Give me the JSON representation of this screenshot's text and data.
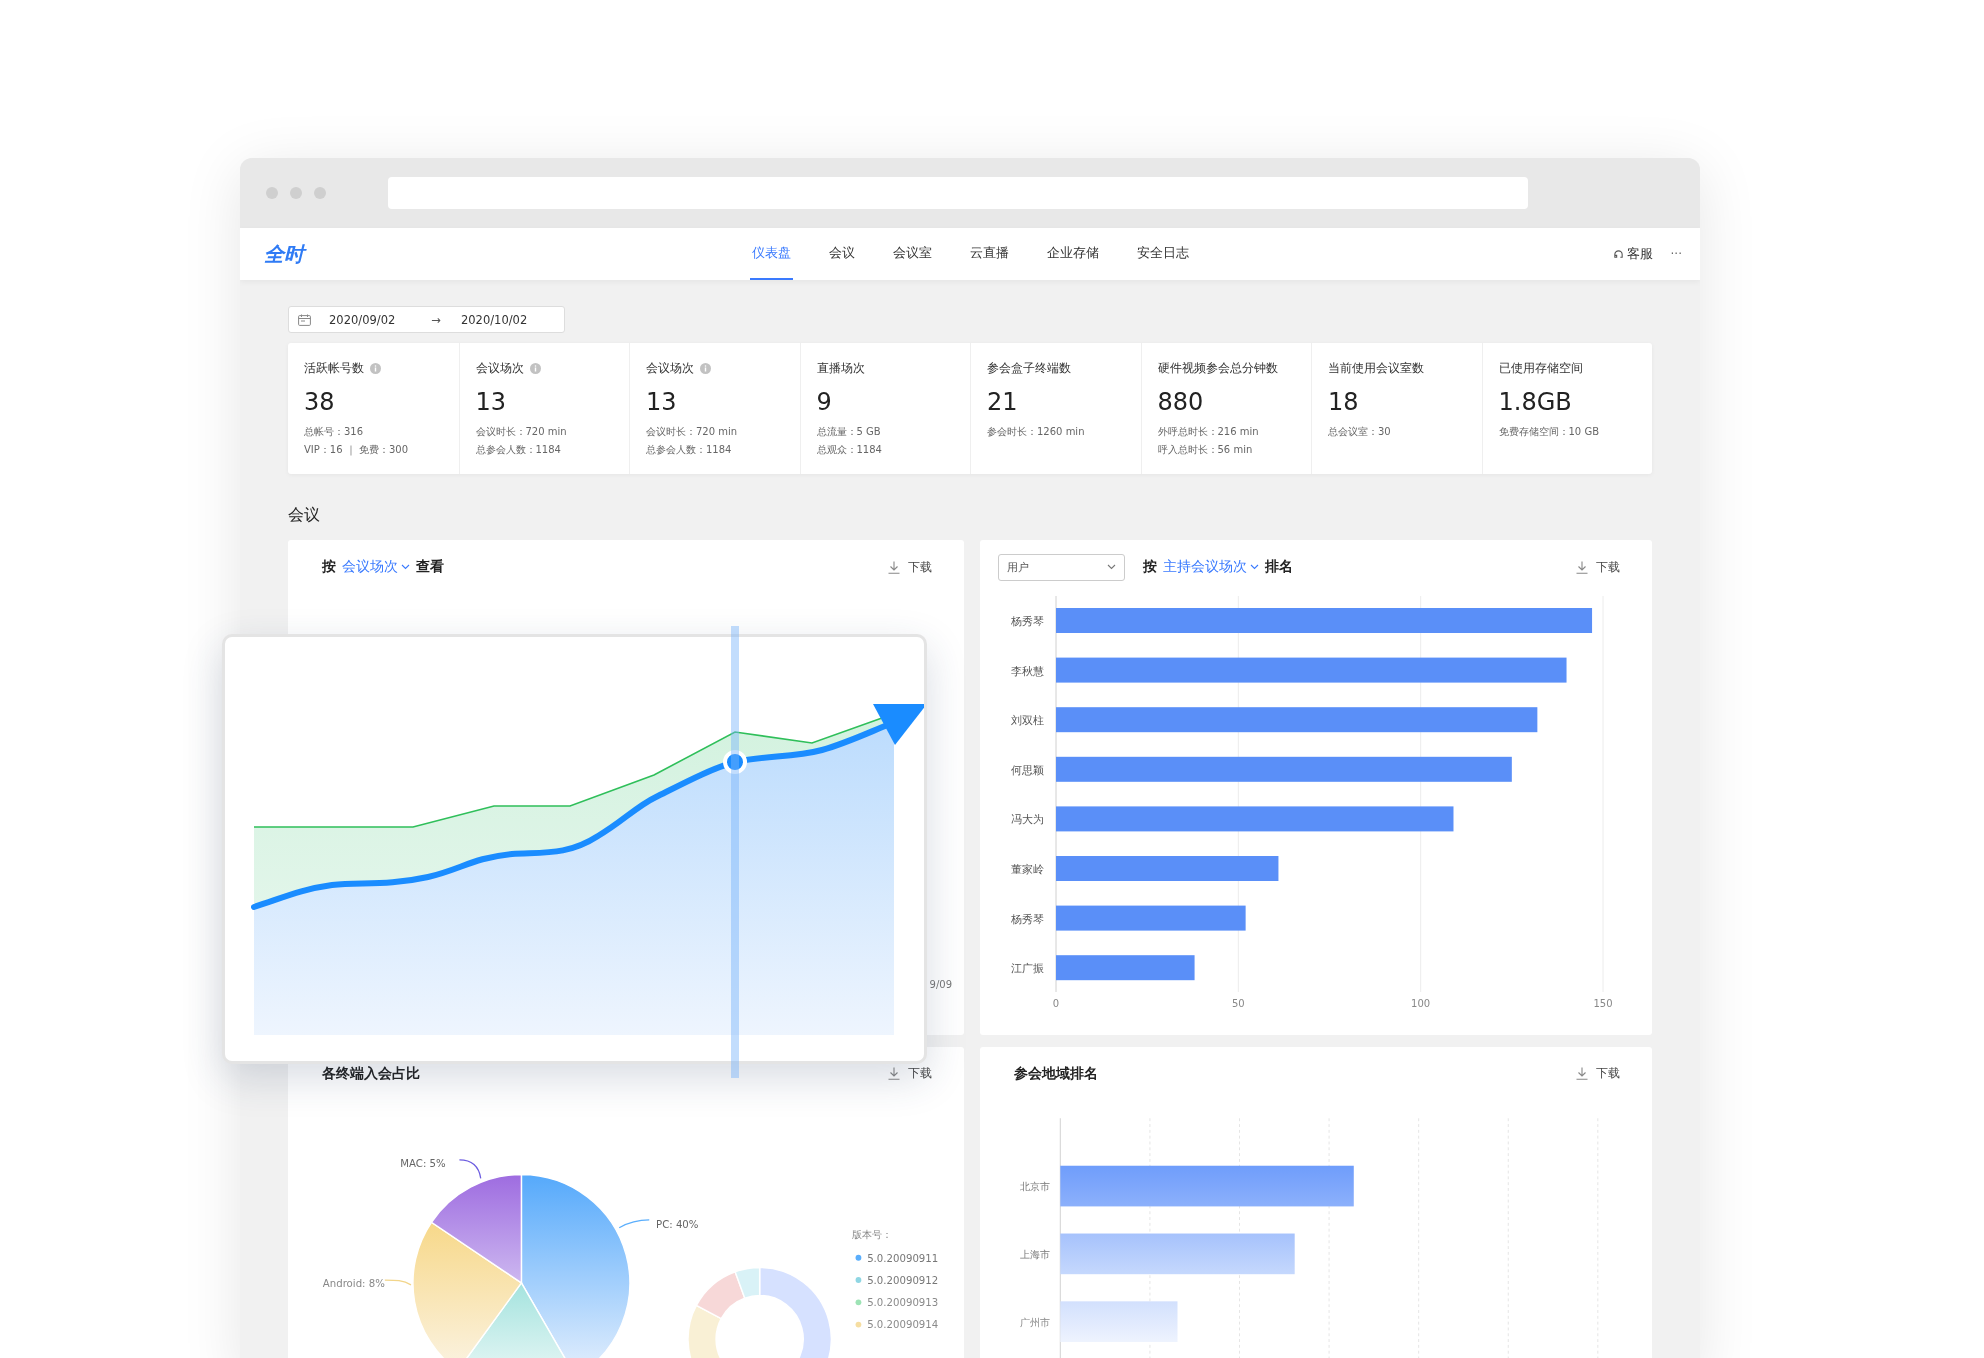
{
  "nav": {
    "logo": "全时",
    "tabs": [
      {
        "label": "仪表盘",
        "selected": true
      },
      {
        "label": "会议",
        "selected": false
      },
      {
        "label": "会议室",
        "selected": false
      },
      {
        "label": "云直播",
        "selected": false
      },
      {
        "label": "企业存储",
        "selected": false
      },
      {
        "label": "安全日志",
        "selected": false
      }
    ],
    "support": "客服",
    "more": "···"
  },
  "date_range": {
    "start": "2020/09/02",
    "separator": "→",
    "end": "2020/10/02"
  },
  "stats": [
    {
      "label": "活跃帐号数",
      "info": true,
      "value": "38",
      "details": [
        "总帐号：316",
        "VIP：16 ｜ 免费：300"
      ]
    },
    {
      "label": "会议场次",
      "info": true,
      "value": "13",
      "details": [
        "会议时长：720 min",
        "总参会人数：1184"
      ]
    },
    {
      "label": "会议场次",
      "info": true,
      "value": "13",
      "details": [
        "会议时长：720 min",
        "总参会人数：1184"
      ]
    },
    {
      "label": "直播场次",
      "info": false,
      "value": "9",
      "details": [
        "总流量：5 GB",
        "总观众：1184"
      ]
    },
    {
      "label": "参会盒子终端数",
      "info": false,
      "value": "21",
      "details": [
        "参会时长：1260 min"
      ]
    },
    {
      "label": "硬件视频参会总分钟数",
      "info": false,
      "value": "880",
      "details": [
        "外呼总时长：216 min",
        "呼入总时长：56 min"
      ]
    },
    {
      "label": "当前使用会议室数",
      "info": false,
      "value": "18",
      "details": [
        "总会议室：30"
      ]
    },
    {
      "label": "已使用存储空间",
      "info": false,
      "value": "1.8GB",
      "details": [
        "免费存储空间：10 GB"
      ]
    }
  ],
  "section_title": "会议",
  "meeting_trend": {
    "prefix": "按",
    "metric": "会议场次",
    "suffix": "查看",
    "download": "下载",
    "x_label": "9/09"
  },
  "host_ranking": {
    "filter": "用户",
    "prefix": "按",
    "metric": "主持会议场次",
    "suffix": "排名",
    "download": "下载",
    "chart_data": {
      "type": "bar",
      "orientation": "horizontal",
      "categories": [
        "杨秀琴",
        "李秋慧",
        "刘双柱",
        "何思颖",
        "冯大为",
        "董家岭",
        "杨秀琴",
        "江广振"
      ],
      "values": [
        147,
        140,
        132,
        125,
        109,
        61,
        52,
        38
      ],
      "xlim": [
        0,
        150
      ],
      "xticks": [
        0,
        50,
        100,
        150
      ]
    }
  },
  "terminal_share": {
    "title": "各终端入会占比",
    "download": "下载",
    "slice_labels": [
      "MAC: 5%",
      "PC: 40%",
      "Android: 8%"
    ],
    "legend_title": "版本号：",
    "versions": [
      {
        "label": "5.0.20090911",
        "color": "#5aaefc"
      },
      {
        "label": "5.0.20090912",
        "color": "#8fd6e3"
      },
      {
        "label": "5.0.20090913",
        "color": "#9de3b5"
      },
      {
        "label": "5.0.20090914",
        "color": "#f6dea2"
      }
    ]
  },
  "region_ranking": {
    "title": "参会地域排名",
    "download": "下载",
    "regions": [
      "北京市",
      "上海市",
      "广州市"
    ]
  }
}
